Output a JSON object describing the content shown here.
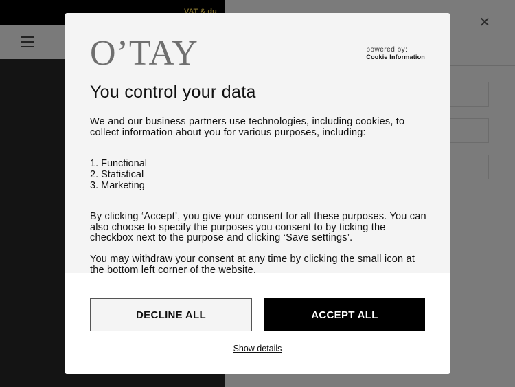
{
  "background": {
    "topbar_text": "VAT & du",
    "colors": {
      "overlay": "#777777",
      "hero": "#141414"
    }
  },
  "modal": {
    "logo": "O’TAY",
    "powered_by": "powered by:",
    "powered_link": "Cookie Information",
    "title": "You control your data",
    "intro": "We and our business partners use technologies, including cookies, to collect information about you for various purposes, including:",
    "purposes": [
      "1. Functional",
      "2. Statistical",
      "3. Marketing"
    ],
    "consent_text": "By clicking ‘Accept’, you give your consent for all these purposes. You can also choose to specify the purposes you consent to by ticking the checkbox next to the purpose and clicking ‘Save settings’.",
    "withdraw_text": "You may withdraw your consent at any time by clicking the small icon at the bottom left corner of the website.",
    "decline_label": "DECLINE ALL",
    "accept_label": "ACCEPT ALL",
    "show_details_label": "Show details",
    "colors": {
      "accept_bg": "#000000",
      "accept_text": "#ffffff",
      "modal_bg": "#f4f4f4"
    }
  },
  "icons": {
    "menu": "hamburger-icon",
    "close": "close-icon"
  }
}
